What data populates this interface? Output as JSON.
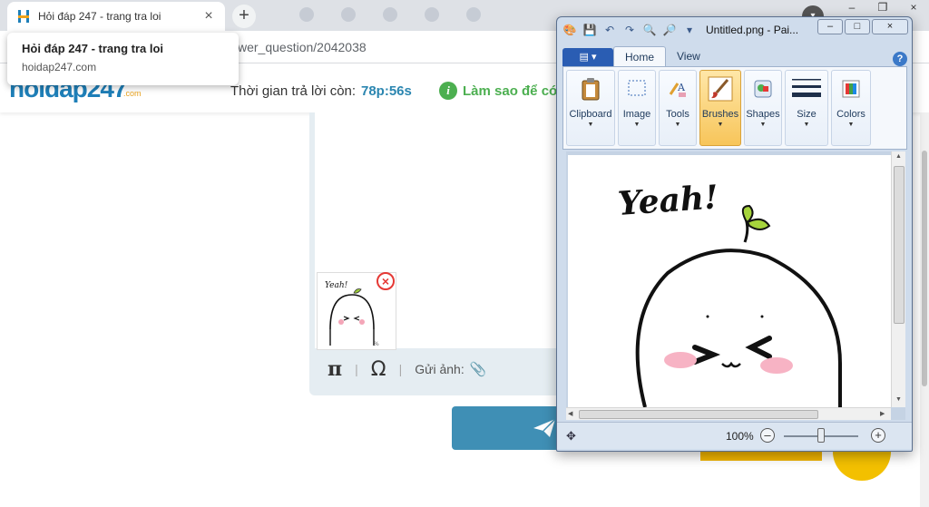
{
  "browser": {
    "tab_title": "Hỏi đáp 247 - trang tra loi",
    "tab_close": "×",
    "new_tab": "+",
    "url_fragment": "wer_question/2042038",
    "profile_icon": "avatar-icon",
    "window_controls": [
      "–",
      "❐",
      "×"
    ]
  },
  "tooltip": {
    "title": "Hỏi đáp 247 - trang tra loi",
    "domain": "hoidap247.com"
  },
  "site": {
    "logo": "hoidap247",
    "logo_tld": ".com",
    "timer_label": "Thời gian trả lời còn:",
    "timer_value": "78p:56s",
    "howto_icon": "i",
    "howto_text": "Làm sao để có",
    "brand_color": "#1e7fb8",
    "accent_color": "#3f8fb5"
  },
  "editor": {
    "pi_symbol": "π",
    "omega_symbol": "Ω",
    "separator": "|",
    "send_image_label": "Gửi ảnh:",
    "clip_icon": "📎",
    "remove_icon": "×",
    "thumb_caption": "Yeah!"
  },
  "paint": {
    "title": "Untitled.png - Pai...",
    "window_buttons": [
      "–",
      "□",
      "×"
    ],
    "app_menu": "▤ ▾",
    "tabs": [
      "Home",
      "View"
    ],
    "active_tab": "Home",
    "help": "?",
    "groups": [
      {
        "label": "Clipboard",
        "icon": "clipboard-icon"
      },
      {
        "label": "Image",
        "icon": "image-select-icon"
      },
      {
        "label": "Tools",
        "icon": "tools-icon"
      },
      {
        "label": "Brushes",
        "icon": "brush-icon",
        "selected": true
      },
      {
        "label": "Shapes",
        "icon": "shapes-icon"
      },
      {
        "label": "Size",
        "icon": "size-icon"
      },
      {
        "label": "Colors",
        "icon": "colors-icon"
      }
    ],
    "dropdown_arrow": "▼",
    "canvas_text": "Yeah!",
    "zoom_level": "100%",
    "zoom_minus": "–",
    "zoom_plus": "+",
    "zoom_slider_fraction": 0.5,
    "move_icon": "✥"
  }
}
